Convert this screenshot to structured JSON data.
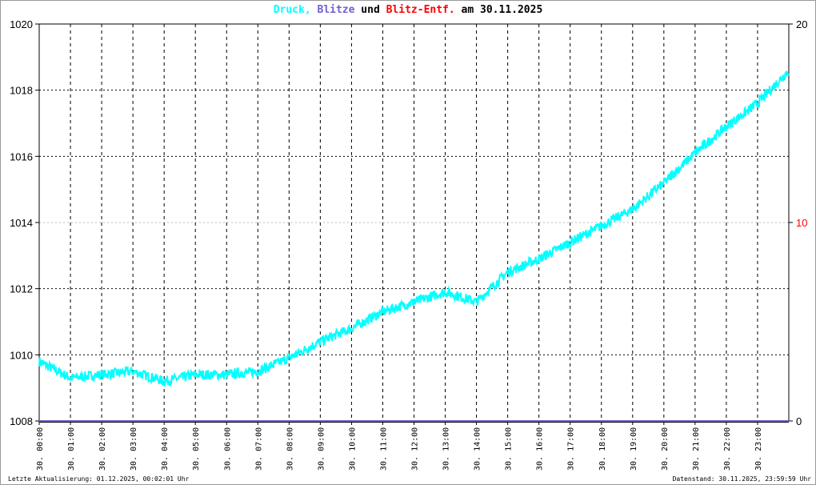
{
  "title": {
    "druck": "Druck,",
    "blitze": "Blitze",
    "und": "und",
    "entf": "Blitz-Entf.",
    "date": "am 30.11.2025"
  },
  "colors": {
    "druck": "#00ffff",
    "blitze": "#7060d0",
    "entf": "#ff0000",
    "axis": "#000000"
  },
  "footer": {
    "left": "Letzte Aktualisierung: 01.12.2025, 00:02:01 Uhr",
    "right": "Datenstand: 30.11.2025, 23:59:59 Uhr"
  },
  "chart_data": {
    "type": "line",
    "title": "Druck, Blitze und Blitz-Entf. am 30.11.2025",
    "y_left": {
      "ylim": [
        1008,
        1020
      ],
      "ticks": [
        "1008",
        "1010",
        "1012",
        "1014",
        "1016",
        "1018",
        "1020"
      ]
    },
    "y_right": {
      "ylim": [
        0,
        20
      ],
      "ticks": [
        "0",
        "10",
        "20"
      ]
    },
    "x_ticks": [
      "30. 00:00",
      "30. 01:00",
      "30. 02:00",
      "30. 03:00",
      "30. 04:00",
      "30. 05:00",
      "30. 06:00",
      "30. 07:00",
      "30. 08:00",
      "30. 09:00",
      "30. 10:00",
      "30. 11:00",
      "30. 12:00",
      "30. 13:00",
      "30. 14:00",
      "30. 15:00",
      "30. 16:00",
      "30. 17:00",
      "30. 18:00",
      "30. 19:00",
      "30. 20:00",
      "30. 21:00",
      "30. 22:00",
      "30. 23:00"
    ],
    "grid": true,
    "series": [
      {
        "name": "Druck",
        "axis": "left",
        "x_hours": [
          0,
          1,
          2,
          3,
          4,
          5,
          6,
          7,
          8,
          9,
          10,
          11,
          12,
          13,
          14,
          15,
          16,
          17,
          18,
          19,
          20,
          21,
          22,
          23,
          24
        ],
        "values": [
          1009.8,
          1009.3,
          1009.4,
          1009.5,
          1009.2,
          1009.4,
          1009.4,
          1009.5,
          1009.9,
          1010.4,
          1010.8,
          1011.3,
          1011.6,
          1011.9,
          1011.6,
          1012.5,
          1012.9,
          1013.4,
          1013.9,
          1014.4,
          1015.2,
          1016.1,
          1016.9,
          1017.6,
          1018.6
        ]
      },
      {
        "name": "Blitze",
        "axis": "right",
        "values": [
          0
        ]
      },
      {
        "name": "Blitz-Entf.",
        "axis": "right",
        "values": []
      }
    ]
  }
}
